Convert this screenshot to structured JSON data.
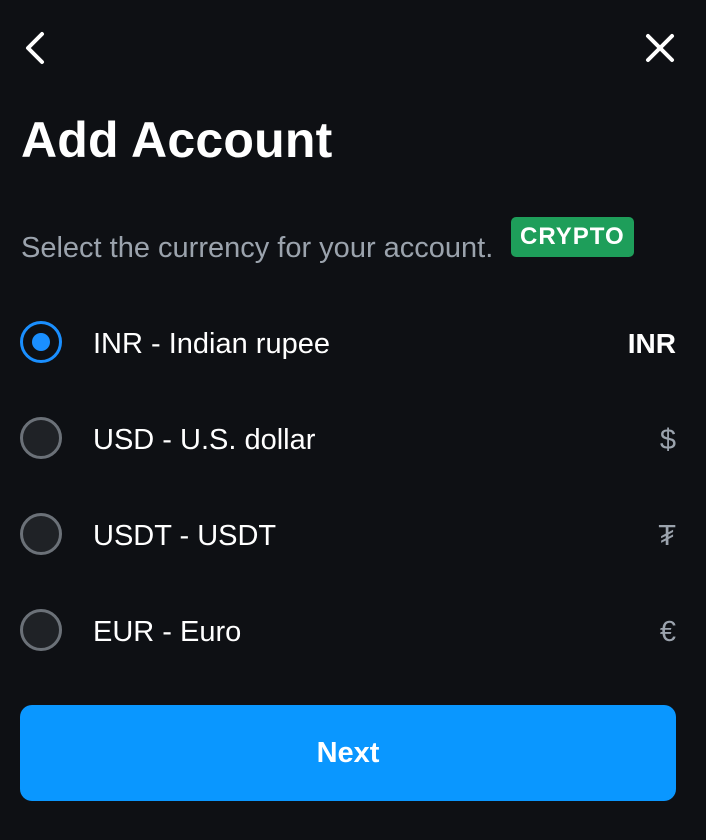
{
  "header": {
    "back_icon": "chevron-left-icon",
    "close_icon": "close-icon",
    "title": "Add Account"
  },
  "subtitle": "Select the currency for your account.",
  "currencies": [
    {
      "label": "INR - Indian rupee",
      "symbol": "INR",
      "selected": true,
      "badge": ""
    },
    {
      "label": "USD - U.S. dollar",
      "symbol": "$",
      "selected": false,
      "badge": ""
    },
    {
      "label": "USDT - USDT",
      "symbol": "₮",
      "selected": false,
      "badge": "CRYPTO"
    },
    {
      "label": "EUR - Euro",
      "symbol": "€",
      "selected": false,
      "badge": ""
    }
  ],
  "next_button": {
    "label": "Next"
  },
  "colors": {
    "background": "#0e1014",
    "accent": "#0a97ff",
    "selected_radio": "#1a8fff",
    "crypto_badge": "#1e9e5a",
    "muted_text": "#9ba3ad"
  }
}
